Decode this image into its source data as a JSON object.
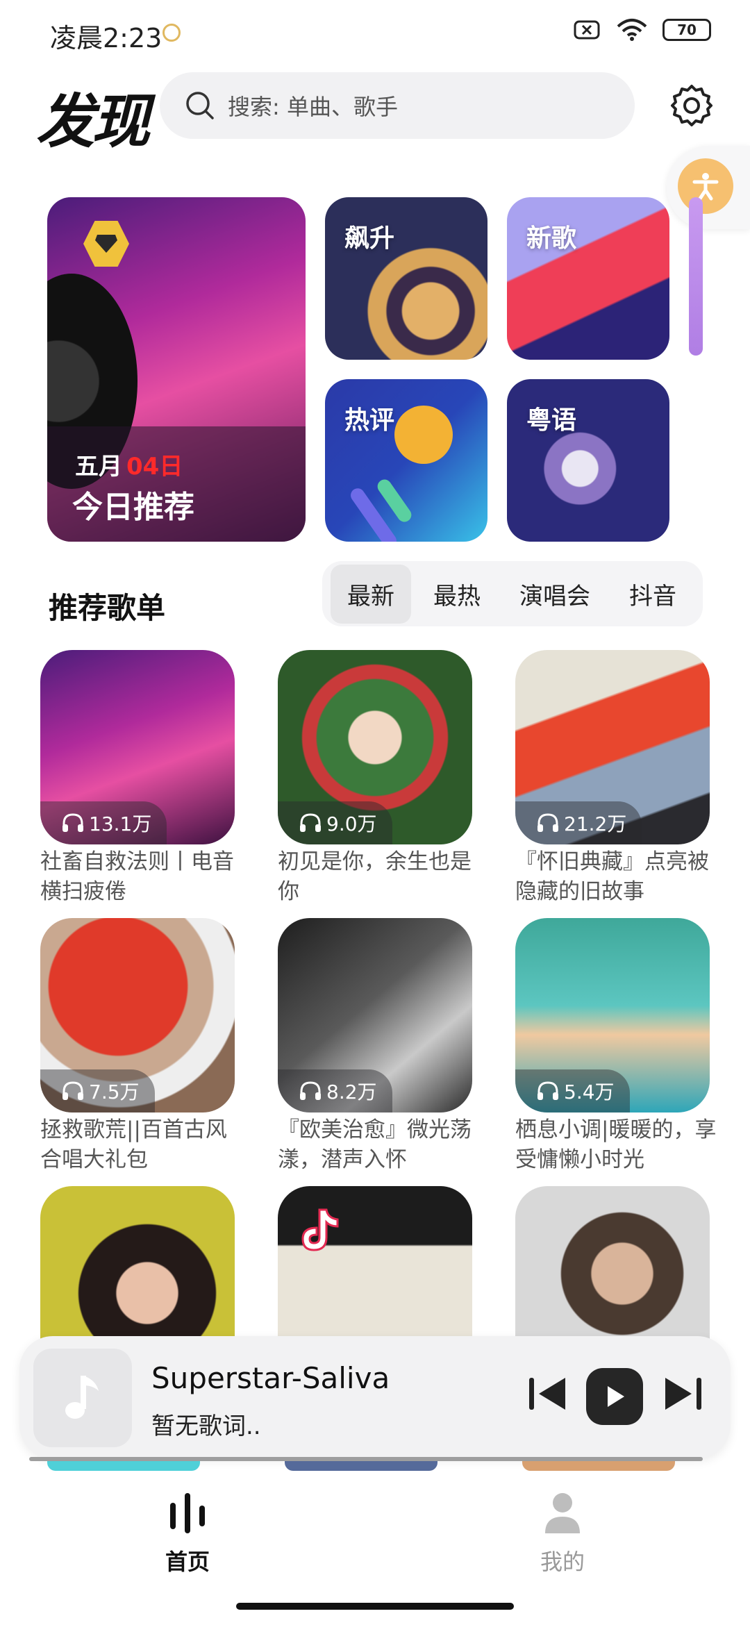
{
  "status": {
    "time": "凌晨2:23",
    "battery": "70"
  },
  "header": {
    "title": "发现",
    "search_placeholder": "搜索: 单曲、歌手"
  },
  "featured": {
    "daily": {
      "month": "五月",
      "day": "04日",
      "title": "今日推荐"
    },
    "tiles": [
      "飙升",
      "新歌",
      "热评",
      "粤语"
    ]
  },
  "section": {
    "title": "推荐歌单",
    "tabs": [
      "最新",
      "最热",
      "演唱会",
      "抖音"
    ],
    "active_tab": "最新"
  },
  "playlists": [
    {
      "count": "13.1万",
      "title": "社畜自救法则丨电音横扫疲倦"
    },
    {
      "count": "9.0万",
      "title": "初见是你，余生也是你"
    },
    {
      "count": "21.2万",
      "title": "『怀旧典藏』点亮被隐藏的旧故事"
    },
    {
      "count": "7.5万",
      "title": "拯救歌荒||百首古风合唱大礼包"
    },
    {
      "count": "8.2万",
      "title": "『欧美治愈』微光荡漾，潜声入怀"
    },
    {
      "count": "5.4万",
      "title": "栖息小调|暖暖的，享受慵懒小时光"
    }
  ],
  "player": {
    "song": "Superstar-Saliva",
    "lyric": "暂无歌词.."
  },
  "nav": [
    {
      "label": "首页",
      "active": true
    },
    {
      "label": "我的",
      "active": false
    }
  ],
  "colors": {
    "accent_red": "#ff2a2a",
    "nav_active": "#111111",
    "nav_inactive": "#999999"
  }
}
